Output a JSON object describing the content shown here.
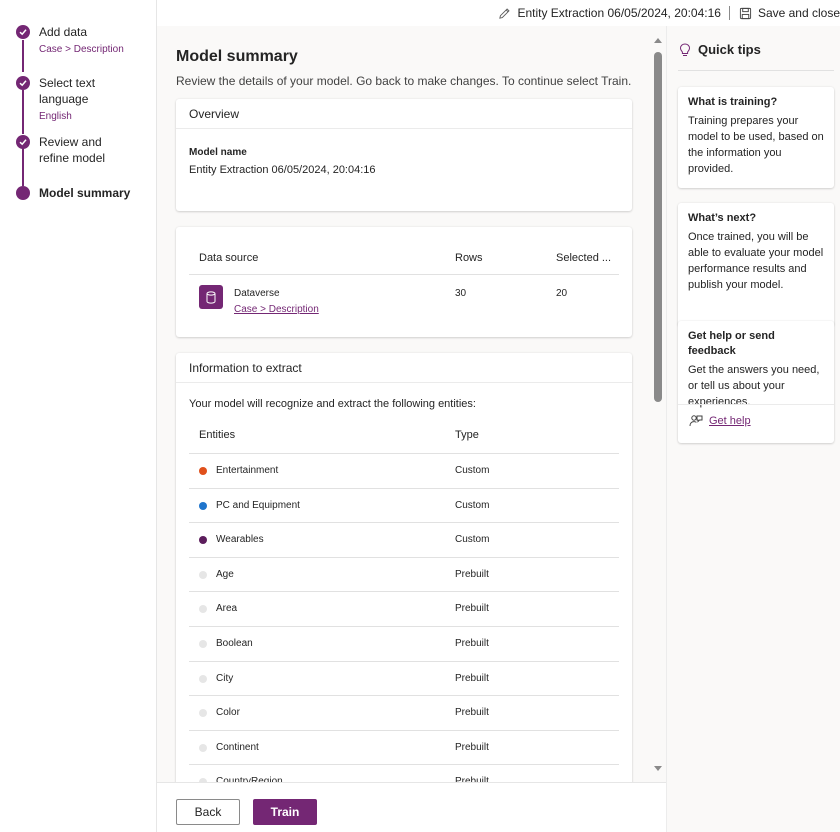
{
  "steps": [
    {
      "title": "Add data",
      "sub": "Case > Description"
    },
    {
      "title": "Select text language",
      "sub": "English"
    },
    {
      "title": "Review and refine model",
      "sub": ""
    },
    {
      "title": "Model summary",
      "sub": ""
    }
  ],
  "topbar": {
    "model_title": "Entity Extraction 06/05/2024, 20:04:16",
    "save_close": "Save and close"
  },
  "main": {
    "title": "Model summary",
    "description": "Review the details of your model. Go back to make changes. To continue select Train.",
    "overview": {
      "header": "Overview",
      "model_name_label": "Model name",
      "model_name_value": "Entity Extraction 06/05/2024, 20:04:16"
    },
    "datasource": {
      "headers": [
        "Data source",
        "Rows",
        "Selected ..."
      ],
      "source_name": "Dataverse",
      "source_link": "Case > Description",
      "rows": "30",
      "selected": "20"
    },
    "extract": {
      "header": "Information to extract",
      "description": "Your model will recognize and extract the following entities:",
      "col_entities": "Entities",
      "col_type": "Type",
      "entities": [
        {
          "name": "Entertainment",
          "type": "Custom",
          "color": "#e0501b"
        },
        {
          "name": "PC and Equipment",
          "type": "Custom",
          "color": "#1f75cc"
        },
        {
          "name": "Wearables",
          "type": "Custom",
          "color": "#5c1d5c"
        },
        {
          "name": "Age",
          "type": "Prebuilt",
          "color": "#e6e6e6"
        },
        {
          "name": "Area",
          "type": "Prebuilt",
          "color": "#e6e6e6"
        },
        {
          "name": "Boolean",
          "type": "Prebuilt",
          "color": "#e6e6e6"
        },
        {
          "name": "City",
          "type": "Prebuilt",
          "color": "#e6e6e6"
        },
        {
          "name": "Color",
          "type": "Prebuilt",
          "color": "#e6e6e6"
        },
        {
          "name": "Continent",
          "type": "Prebuilt",
          "color": "#e6e6e6"
        },
        {
          "name": "CountryRegion",
          "type": "Prebuilt",
          "color": "#e6e6e6"
        }
      ]
    }
  },
  "buttons": {
    "back": "Back",
    "train": "Train"
  },
  "tips": {
    "header": "Quick tips",
    "cards": [
      {
        "title": "What is training?",
        "body": "Training prepares your model to be used, based on the information you provided."
      },
      {
        "title": "What’s next?",
        "body": "Once trained, you will be able to evaluate your model performance results and publish your model."
      },
      {
        "title": "Get help or send feedback",
        "body": "Get the answers you need, or tell us about your experiences.",
        "link": "Get help"
      }
    ]
  },
  "colors": {
    "accent": "#742774"
  }
}
